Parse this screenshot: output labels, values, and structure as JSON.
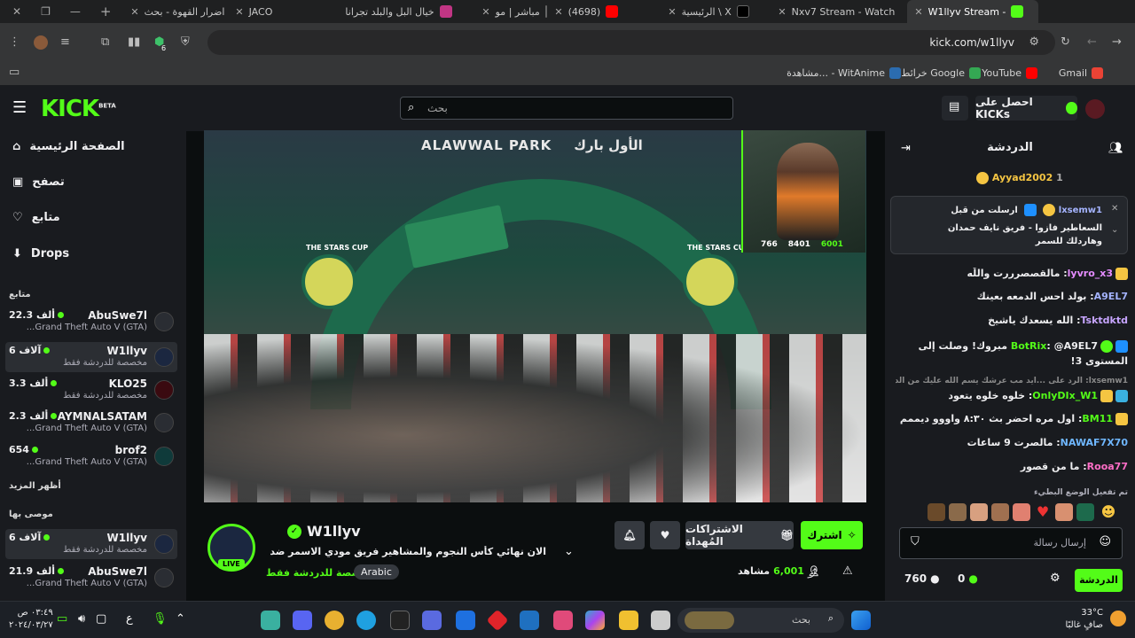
{
  "browser": {
    "tabs": [
      {
        "label": "",
        "color": "#888"
      },
      {
        "label": "اضرار القهوة - بحث",
        "color": "#4285f4"
      },
      {
        "label": "JACO",
        "color": "#555"
      },
      {
        "label": "خيال البل والبلد تجرانا",
        "color": "#c13584"
      },
      {
        "label": "مباشر | مو",
        "color": "#111"
      },
      {
        "label": "(4698)",
        "color": "#ff0000"
      },
      {
        "label": "الرئيسية \\ X",
        "color": "#000"
      },
      {
        "label": "Nxv7 Stream - Watch",
        "color": "#000"
      },
      {
        "label": "W1llyv Stream -",
        "color": "#53fc18"
      }
    ],
    "url": "kick.com/w1llyv",
    "extension_badge": "6",
    "bookmarks": [
      {
        "label": "Gmail",
        "color": "#ea4335"
      },
      {
        "label": "YouTube",
        "color": "#ff0000"
      },
      {
        "label": "خرائط Google",
        "color": "#34a853"
      },
      {
        "label": "مشاهدة... - WitAnime",
        "color": "#2b6cb0"
      }
    ]
  },
  "kick": {
    "logo": "KICK",
    "logo_badge": "BETA",
    "search_placeholder": "بحث",
    "get_kicks": "احصل على KICKs"
  },
  "sidebar": {
    "nav": [
      {
        "label": "الصفحة الرئيسية",
        "icon": "home-icon"
      },
      {
        "label": "تصفح",
        "icon": "browse-icon"
      },
      {
        "label": "متابع",
        "icon": "heart-icon"
      },
      {
        "label": "Drops",
        "icon": "drops-icon"
      }
    ],
    "following_label": "متابع",
    "following": [
      {
        "name": "AbuSwe7l",
        "viewers": "22.3 ألف",
        "game": "...Grand Theft Auto V (GTA)",
        "selected": false
      },
      {
        "name": "W1llyv",
        "viewers": "6 آلاف",
        "game": "مخصصة للدردشة فقط",
        "selected": true
      },
      {
        "name": "KLO25",
        "viewers": "3.3 ألف",
        "game": "مخصصة للدردشة فقط",
        "selected": false
      },
      {
        "name": "AYMNALSATAM",
        "viewers": "2.3 ألف",
        "game": "...Grand Theft Auto V (GTA)",
        "selected": false
      },
      {
        "name": "brof2",
        "viewers": "654",
        "game": "...Grand Theft Auto V (GTA)",
        "selected": false
      }
    ],
    "show_more": "أظهر المزيد",
    "recommended_label": "موصى بها",
    "recommended": [
      {
        "name": "W1llyv",
        "viewers": "6 آلاف",
        "game": "مخصصة للدردشة فقط",
        "selected": true
      },
      {
        "name": "AbuSwe7l",
        "viewers": "21.9 ألف",
        "game": "...Grand Theft Auto V (GTA)",
        "selected": false
      }
    ]
  },
  "video": {
    "venue_en": "ALAWWAL PARK",
    "venue_ar": "الأول بارك",
    "cup_label": "THE STARS CUP",
    "cam_stats": [
      "766",
      "8401",
      "6001"
    ]
  },
  "stream": {
    "name": "W1llyv",
    "title": "الان نهائي كأس النجوم والمشاهير فريق مودي الاسمر ضد فريق نايف حمدان ...",
    "category": "مخصصة للدردشة فقط",
    "tag": "Arabic",
    "viewers": "6,001",
    "viewers_label": "مشاهد",
    "subscribe": "اشترك",
    "gift_subs": "الاشتراكات المُهداة",
    "live_badge": "LIVE"
  },
  "chat": {
    "header": "الدردشة",
    "top_gifter": {
      "name": "Ayyad2002",
      "count": "1"
    },
    "pinned": {
      "user": "lxsemw1",
      "text": "ارسلت من قبل",
      "message": "السعاطير فازوا - فريق نايف حمدان وهاردلك للسمر"
    },
    "messages": [
      {
        "user": "lyvro_x3",
        "text": "مالقصصرررت واللّه",
        "color": "#e58cff",
        "badge": "#f5c542"
      },
      {
        "user": "A9EL7",
        "text": "بولد احس الدمعه بعينك",
        "color": "#a5b4ff",
        "badge": ""
      },
      {
        "user": "Tsktdktd",
        "text": "الله يسعدك ياشيخ",
        "color": "#c7a5ff",
        "badge": ""
      },
      {
        "user": "BotRix",
        "text": "@A9EL7 مبروك! وصلت إلى المستوى 3!",
        "color": "#53fc18",
        "badge": "#1e90ff"
      },
      {
        "user": "lxsemw1",
        "text": "الرد على ...ايد مب عرشك يسم الله عليك من الدرامات",
        "color": "#8a8a8a",
        "badge": ""
      },
      {
        "user": "OnlyDIx_W1",
        "text": "خلوه خلوه يتعود",
        "color": "#53fc18",
        "badge": "#f5c542"
      },
      {
        "user": "BM11",
        "text": "اول مره احضر بث ٨:٣٠ واووو ديممم",
        "color": "#53fc18",
        "badge": "#f5c542"
      },
      {
        "user": "NAWAF7X70",
        "text": "مالصرت 9 ساعات",
        "color": "#6fb7ff",
        "badge": ""
      },
      {
        "user": "Rooa77",
        "text": "ما من قصور",
        "color": "#ff6ec7",
        "badge": ""
      }
    ],
    "slow_mode": "تم تفعيل الوضع البطيء",
    "input_placeholder": "إرسال رسالة",
    "send": "الدردشة",
    "kicks_count": "0",
    "points": "760"
  },
  "taskbar": {
    "search": "بحث",
    "time": "٠٣:٤٩ ص",
    "date": "٢٠٢٤/٠٣/٢٧",
    "lang": "ع",
    "weather_temp": "33°C",
    "weather_text": "صافٍ غالبًا"
  },
  "colors": {
    "kick_green": "#53fc18",
    "panel": "#191b1f",
    "bg": "#0b0e0f"
  }
}
